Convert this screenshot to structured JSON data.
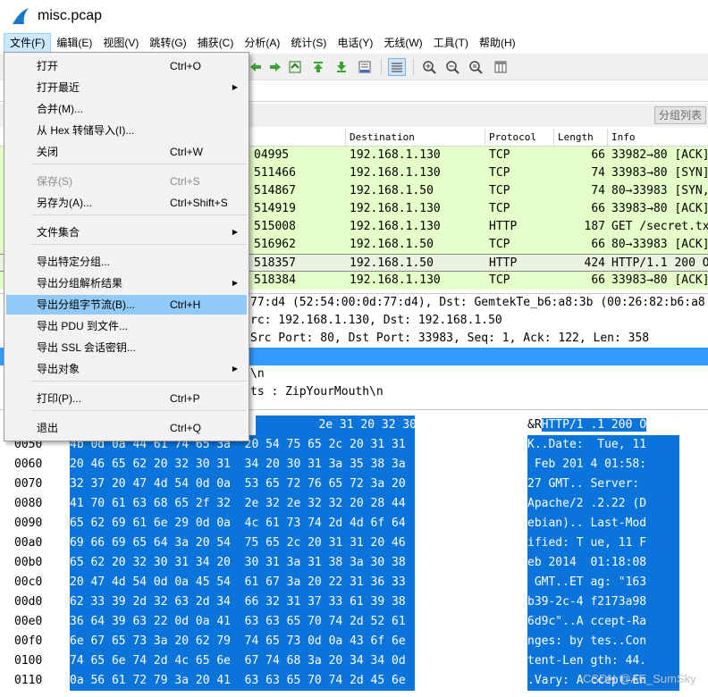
{
  "window": {
    "title": "misc.pcap"
  },
  "menubar": [
    {
      "label": "文件(F)",
      "active": true
    },
    {
      "label": "编辑(E)"
    },
    {
      "label": "视图(V)"
    },
    {
      "label": "跳转(G)"
    },
    {
      "label": "捕获(C)"
    },
    {
      "label": "分析(A)"
    },
    {
      "label": "统计(S)"
    },
    {
      "label": "电话(Y)"
    },
    {
      "label": "无线(W)"
    },
    {
      "label": "工具(T)"
    },
    {
      "label": "帮助(H)"
    }
  ],
  "filter_strip": {
    "packet_list_button": "分组列表"
  },
  "packet_list": {
    "columns": {
      "destination": "Destination",
      "protocol": "Protocol",
      "length": "Length",
      "info": "Info"
    },
    "rows": [
      {
        "time": "04995",
        "dst": "192.168.1.130",
        "proto": "TCP",
        "len": "66",
        "info": "33982→80 [ACK]"
      },
      {
        "time": "511466",
        "dst": "192.168.1.130",
        "proto": "TCP",
        "len": "74",
        "info": "33983→80 [SYN]"
      },
      {
        "time": "514867",
        "dst": "192.168.1.50",
        "proto": "TCP",
        "len": "74",
        "info": "80→33983 [SYN,"
      },
      {
        "time": "514919",
        "dst": "192.168.1.130",
        "proto": "TCP",
        "len": "66",
        "info": "33983→80 [ACK]"
      },
      {
        "time": "515008",
        "dst": "192.168.1.130",
        "proto": "HTTP",
        "len": "187",
        "info": "GET /secret.tx"
      },
      {
        "time": "516962",
        "dst": "192.168.1.50",
        "proto": "TCP",
        "len": "66",
        "info": "80→33983 [ACK]"
      },
      {
        "time": "518357",
        "dst": "192.168.1.50",
        "proto": "HTTP",
        "len": "424",
        "info": "HTTP/1.1 200 O"
      },
      {
        "time": "518384",
        "dst": "192.168.1.130",
        "proto": "TCP",
        "len": "66",
        "info": "33983→80 [ACK]"
      }
    ]
  },
  "details": [
    "77:d4 (52:54:00:0d:77:d4), Dst: GemtekTe_b6:a8:3b (00:26:82:b6:a8",
    "rc: 192.168.1.130, Dst: 192.168.1.50",
    " Src Port: 80, Dst Port: 33983, Seq: 1, Ack: 122, Len: 358",
    "",
    "\\n",
    "ts : ZipYourMouth\\n"
  ],
  "bytes": [
    {
      "off": "",
      "hex": "         2e 31 20 32 30 30 20 4f",
      "pre": "&R",
      "asc": "HTTP/1 .1 200 O"
    },
    {
      "off": "0050",
      "hex": "4b 0d 0a 44 61 74 65 3a  20 54 75 65 2c 20 31 31",
      "pre": "",
      "asc": "K..Date:  Tue, 11"
    },
    {
      "off": "0060",
      "hex": "20 46 65 62 20 32 30 31  34 20 30 31 3a 35 38 3a",
      "pre": "",
      "asc": " Feb 201 4 01:58:"
    },
    {
      "off": "0070",
      "hex": "32 37 20 47 4d 54 0d 0a  53 65 72 76 65 72 3a 20",
      "pre": "",
      "asc": "27 GMT.. Server: "
    },
    {
      "off": "0080",
      "hex": "41 70 61 63 68 65 2f 32  2e 32 2e 32 32 20 28 44",
      "pre": "",
      "asc": "Apache/2 .2.22 (D"
    },
    {
      "off": "0090",
      "hex": "65 62 69 61 6e 29 0d 0a  4c 61 73 74 2d 4d 6f 64",
      "pre": "",
      "asc": "ebian).. Last-Mod"
    },
    {
      "off": "00a0",
      "hex": "69 66 69 65 64 3a 20 54  75 65 2c 20 31 31 20 46",
      "pre": "",
      "asc": "ified: T ue, 11 F"
    },
    {
      "off": "00b0",
      "hex": "65 62 20 32 30 31 34 20  30 31 3a 31 38 3a 30 38",
      "pre": "",
      "asc": "eb 2014  01:18:08"
    },
    {
      "off": "00c0",
      "hex": "20 47 4d 54 0d 0a 45 54  61 67 3a 20 22 31 36 33",
      "pre": "",
      "asc": " GMT..ET ag: \"163"
    },
    {
      "off": "00d0",
      "hex": "62 33 39 2d 32 63 2d 34  66 32 31 37 33 61 39 38",
      "pre": "",
      "asc": "b39-2c-4 f2173a98"
    },
    {
      "off": "00e0",
      "hex": "36 64 39 63 22 0d 0a 41  63 63 65 70 74 2d 52 61",
      "pre": "",
      "asc": "6d9c\"..A ccept-Ra"
    },
    {
      "off": "00f0",
      "hex": "6e 67 65 73 3a 20 62 79  74 65 73 0d 0a 43 6f 6e",
      "pre": "",
      "asc": "nges: by tes..Con"
    },
    {
      "off": "0100",
      "hex": "74 65 6e 74 2d 4c 65 6e  67 74 68 3a 20 34 34 0d",
      "pre": "",
      "asc": "tent-Len gth: 44."
    },
    {
      "off": "0110",
      "hex": "0a 56 61 72 79 3a 20 41  63 63 65 70 74 2d 45 6e",
      "pre": "",
      "asc": ".Vary: A ccept-En"
    }
  ],
  "file_menu": {
    "items": [
      {
        "label": "打开",
        "shortcut": "Ctrl+O"
      },
      {
        "label": "打开最近",
        "submenu": true
      },
      {
        "label": "合并(M)..."
      },
      {
        "label": "从 Hex 转储导入(I)..."
      },
      {
        "label": "关闭",
        "shortcut": "Ctrl+W"
      },
      {
        "label": "保存(S)",
        "shortcut": "Ctrl+S",
        "disabled": true
      },
      {
        "label": "另存为(A)...",
        "shortcut": "Ctrl+Shift+S"
      },
      {
        "label": "文件集合",
        "submenu": true
      },
      {
        "label": "导出特定分组..."
      },
      {
        "label": "导出分组解析结果",
        "submenu": true
      },
      {
        "label": "导出分组字节流(B)...",
        "shortcut": "Ctrl+H",
        "highlighted": true
      },
      {
        "label": "导出 PDU 到文件..."
      },
      {
        "label": "导出 SSL 会话密钥..."
      },
      {
        "label": "导出对象",
        "submenu": true
      },
      {
        "label": "打印(P)...",
        "shortcut": "Ctrl+P"
      },
      {
        "label": "退出",
        "shortcut": "Ctrl+Q"
      }
    ]
  },
  "watermark": "CSDN @AE_SumSky",
  "colors": {
    "accent": "#0a74da",
    "tcp_row": "#e4ffc7",
    "selected_detail": "#3399ff",
    "menu_highlight": "#91c9f7"
  }
}
